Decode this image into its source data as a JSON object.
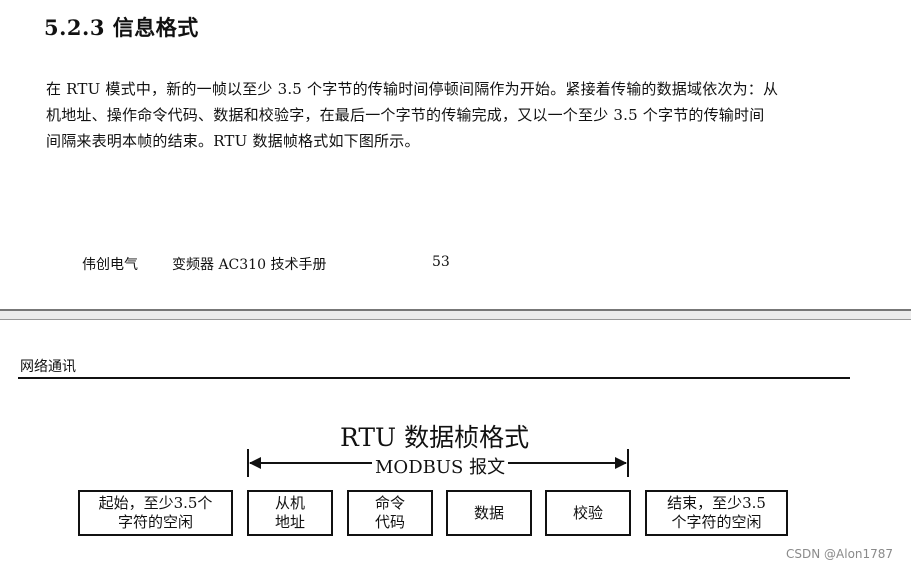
{
  "section": {
    "heading": "5.2.3 信息格式",
    "paragraph_lines": [
      "在 RTU 模式中，新的一帧以至少 3.5 个字节的传输时间停顿间隔作为开始。紧接着传输的数据域依次为：从",
      "机地址、操作命令代码、数据和校验字，在最后一个字节的传输完成，又以一个至少 3.5 个字节的传输时间",
      "间隔来表明本帧的结束。RTU 数据帧格式如下图所示。"
    ]
  },
  "footer": {
    "company": "伟创电气",
    "manual": "变频器 AC310 技术手册",
    "page_number": "53"
  },
  "next_page": {
    "header_label": "网络通讯"
  },
  "diagram": {
    "title": "RTU 数据桢格式",
    "span_label": "MODBUS 报文",
    "fields": [
      {
        "line1": "起始，至少3.5个",
        "line2": "字符的空闲"
      },
      {
        "line1": "从机",
        "line2": "地址"
      },
      {
        "line1": "命令",
        "line2": "代码"
      },
      {
        "line1": "数据",
        "line2": ""
      },
      {
        "line1": "校验",
        "line2": ""
      },
      {
        "line1": "结束，至少3.5",
        "line2": "个字符的空闲"
      }
    ]
  },
  "watermark": "CSDN @Alon1787"
}
